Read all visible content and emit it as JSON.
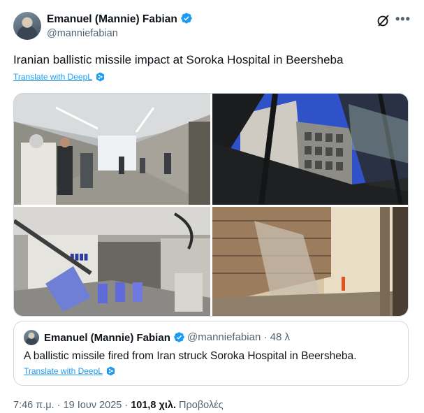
{
  "author": {
    "name": "Emanuel (Mannie) Fabian",
    "handle": "@manniefabian",
    "avatar_icon": "avatar-photo",
    "verified_icon": "verified-badge-icon"
  },
  "actions": {
    "grok_icon": "grok-icon",
    "more_label": "•••"
  },
  "tweet": {
    "text": "Iranian ballistic missile impact at Soroka Hospital in Beersheba",
    "translate_label": "Translate with DeepL"
  },
  "media": {
    "images": [
      {
        "name": "hospital-corridor-photo"
      },
      {
        "name": "damaged-building-facade-photo"
      },
      {
        "name": "damaged-lobby-photo"
      },
      {
        "name": "collapsed-facade-street-photo"
      }
    ]
  },
  "quote": {
    "name": "Emanuel (Mannie) Fabian",
    "handle": "@manniefabian",
    "time": "48 λ",
    "separator": "·",
    "text": "A ballistic missile fired from Iran struck Soroka Hospital in Beersheba.",
    "translate_label": "Translate with DeepL"
  },
  "meta": {
    "time": "7:46 π.μ.",
    "separator": "·",
    "date": "19 Ιουν 2025",
    "views_count": "101,8 χιλ.",
    "views_label": "Προβολές"
  },
  "colors": {
    "accent": "#1d9bf0",
    "text": "#0f1419",
    "secondary": "#536471",
    "border": "#cfd9de"
  }
}
